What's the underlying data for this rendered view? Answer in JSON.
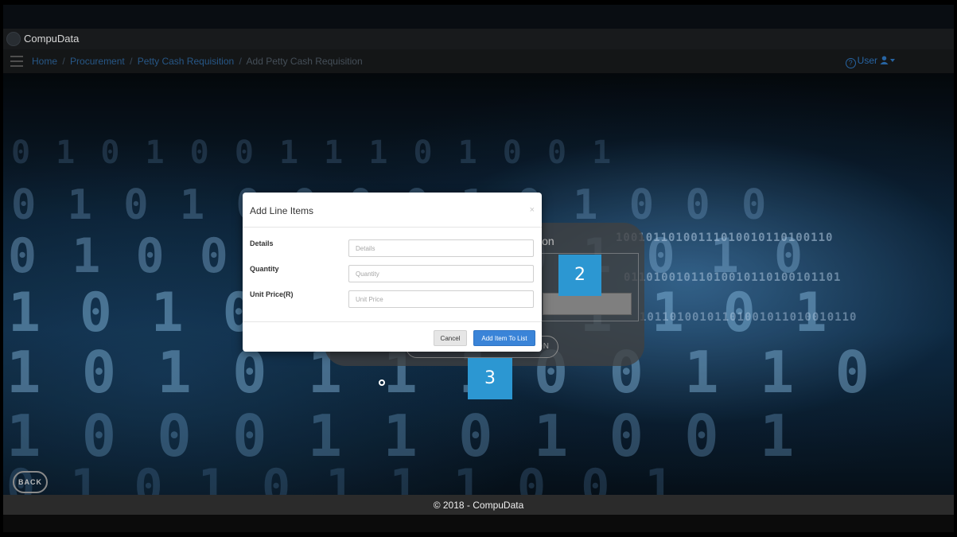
{
  "header": {
    "brand": "CompuData"
  },
  "breadcrumb": {
    "items": [
      "Home",
      "Procurement",
      "Petty Cash Requisition"
    ],
    "current": "Add Petty Cash Requisition",
    "separator": "/"
  },
  "user_menu": {
    "help_glyph": "?",
    "label": "User"
  },
  "modal": {
    "title": "Add Line Items",
    "close": "×",
    "fields": [
      {
        "label": "Details",
        "placeholder": "Details",
        "value": ""
      },
      {
        "label": "Quantity",
        "placeholder": "Quantity",
        "value": ""
      },
      {
        "label": "Unit Price(R)",
        "placeholder": "Unit Price",
        "value": ""
      }
    ],
    "cancel_label": "Cancel",
    "add_label": "Add Item To List"
  },
  "background_panel": {
    "title_fragment": "ion",
    "button_fragment": "ON"
  },
  "markers": [
    "2",
    "3"
  ],
  "back_label": "BACK",
  "footer": {
    "text": "© 2018 - CompuData"
  },
  "background_digits": {
    "row1": "0 1 0 1 0 0 1 1 1 0 1 0 0 1",
    "row2": "0 1 0 1 0 0 0 0 1 0 1 0 0 0",
    "row3": "0 1 0 0 0 1 0 1 0 1 0 1 0",
    "row4": "1 0 1 0 1 0 0 0 1 1 0 1",
    "row5": "1 0 1 0 1 1 1 0 0 1 1 0",
    "row6": "1 0 0 0 1 1 0 1 0 0 1",
    "row7": "0 1 0 1 0 1 1 1 0 0 1",
    "right1": "10010110100111010010110100110",
    "right2": "01101001011010010110100101101",
    "right3": "10110100101101001011010010110"
  },
  "colors": {
    "accent": "#3a84d8",
    "marker": "#2c97d2",
    "breadcrumb_link": "#2b5f92",
    "footer_bg": "#2b2b2b"
  },
  "icons": [
    "hamburger-menu-icon",
    "help-circle-icon",
    "user-icon",
    "caret-down-icon",
    "close-icon",
    "logo-icon",
    "cursor-icon"
  ]
}
